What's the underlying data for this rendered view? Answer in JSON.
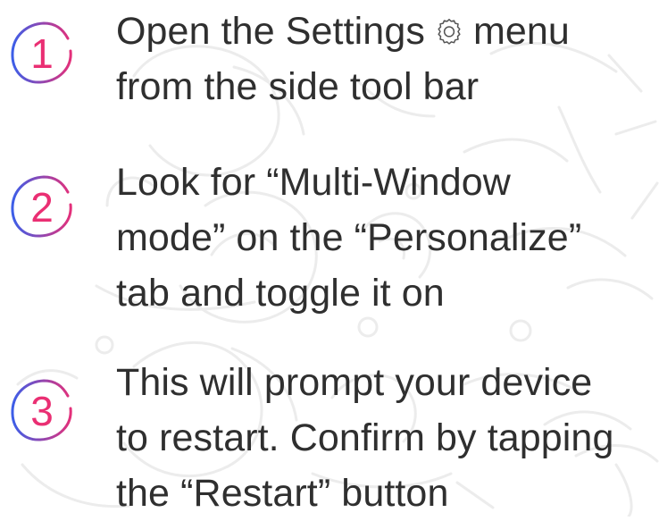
{
  "steps": [
    {
      "number": "1",
      "lines": [
        {
          "before": "Open the Settings",
          "icon": "gear-icon",
          "after": "menu"
        },
        {
          "text": "from the side tool bar"
        }
      ]
    },
    {
      "number": "2",
      "lines": [
        {
          "text": "Look for “Multi-Window"
        },
        {
          "text": "mode” on the “Personalize”"
        },
        {
          "text": "tab and toggle it on"
        }
      ]
    },
    {
      "number": "3",
      "lines": [
        {
          "text": "This will prompt your device"
        },
        {
          "text": "to restart. Confirm by tapping"
        },
        {
          "text": "the “Restart” button"
        }
      ]
    }
  ],
  "colors": {
    "text": "#2f2f2f",
    "badge_number": "#ea2f73",
    "badge_ring_start": "#3c5ee8",
    "badge_ring_end": "#e4307a",
    "sketch": "#ececec"
  }
}
